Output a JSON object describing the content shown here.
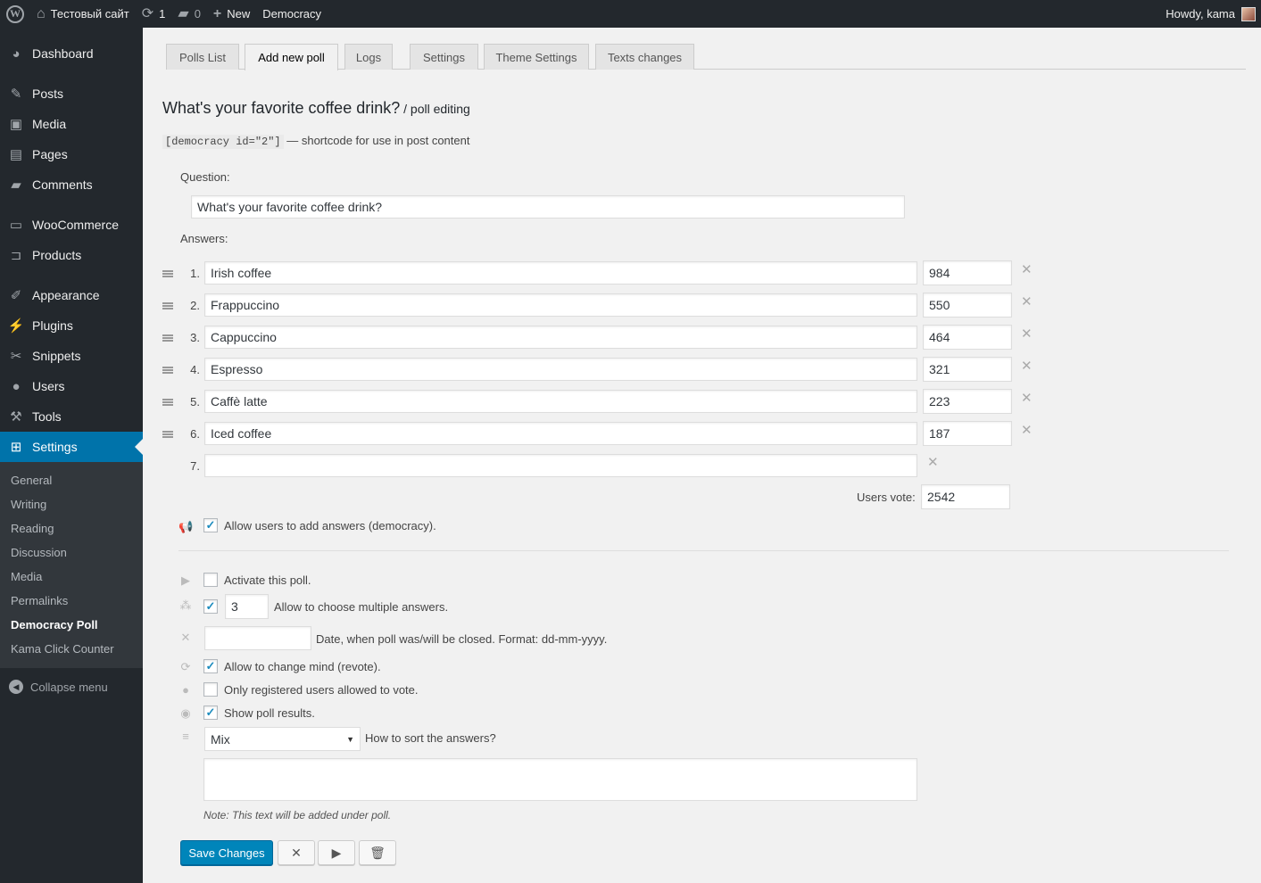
{
  "adminbar": {
    "site_name": "Тестовый сайт",
    "updates_count": "1",
    "comments_count": "0",
    "new_label": "New",
    "democracy_label": "Democracy",
    "howdy": "Howdy, kama"
  },
  "sidebar": {
    "items": [
      {
        "label": "Dashboard",
        "icon": "dashboard-icon",
        "glyph": "◕"
      },
      {
        "label": "Posts",
        "icon": "pin-icon",
        "glyph": "✎"
      },
      {
        "label": "Media",
        "icon": "media-icon",
        "glyph": "▣"
      },
      {
        "label": "Pages",
        "icon": "pages-icon",
        "glyph": "▤"
      },
      {
        "label": "Comments",
        "icon": "comment-icon",
        "glyph": "▰"
      },
      {
        "label": "WooCommerce",
        "icon": "woocommerce-icon",
        "glyph": "▭"
      },
      {
        "label": "Products",
        "icon": "cart-icon",
        "glyph": "⊐"
      },
      {
        "label": "Appearance",
        "icon": "brush-icon",
        "glyph": "✐"
      },
      {
        "label": "Plugins",
        "icon": "plug-icon",
        "glyph": "⚡"
      },
      {
        "label": "Snippets",
        "icon": "scissors-icon",
        "glyph": "✂"
      },
      {
        "label": "Users",
        "icon": "user-icon",
        "glyph": "●"
      },
      {
        "label": "Tools",
        "icon": "wrench-icon",
        "glyph": "⚒"
      },
      {
        "label": "Settings",
        "icon": "settings-icon",
        "glyph": "⊞"
      }
    ],
    "submenu": [
      "General",
      "Writing",
      "Reading",
      "Discussion",
      "Media",
      "Permalinks",
      "Democracy Poll",
      "Kama Click Counter"
    ],
    "collapse": "Collapse menu"
  },
  "tabs": [
    "Polls List",
    "Add new poll",
    "Logs",
    "Settings",
    "Theme Settings",
    "Texts changes"
  ],
  "title": "What's your favorite coffee drink?",
  "title_suffix": " / poll editing",
  "shortcode": "[democracy id=\"2\"]",
  "shortcode_note": " — shortcode for use in post content",
  "question_label": "Question:",
  "question_value": "What's your favorite coffee drink?",
  "answers_label": "Answers:",
  "answers": [
    {
      "num": "1.",
      "text": "Irish coffee",
      "votes": "984"
    },
    {
      "num": "2.",
      "text": "Frappuccino",
      "votes": "550"
    },
    {
      "num": "3.",
      "text": "Cappuccino",
      "votes": "464"
    },
    {
      "num": "4.",
      "text": "Espresso",
      "votes": "321"
    },
    {
      "num": "5.",
      "text": "Caffè latte",
      "votes": "223"
    },
    {
      "num": "6.",
      "text": "Iced coffee",
      "votes": "187"
    },
    {
      "num": "7.",
      "text": "",
      "votes": ""
    }
  ],
  "users_vote_label": "Users vote:",
  "users_vote_value": "2542",
  "options": {
    "democracy": {
      "label": "Allow users to add answers (democracy).",
      "checked": true
    },
    "activate": {
      "label": "Activate this poll.",
      "checked": false
    },
    "multiple": {
      "label": "Allow to choose multiple answers.",
      "checked": true,
      "value": "3"
    },
    "end_date": {
      "label": "Date, when poll was/will be closed. Format: dd-mm-yyyy.",
      "value": ""
    },
    "revote": {
      "label": "Allow to change mind (revote).",
      "checked": true
    },
    "only_registered": {
      "label": "Only registered users allowed to vote.",
      "checked": false
    },
    "show_results": {
      "label": "Show poll results.",
      "checked": true
    },
    "sort": {
      "label": "How to sort the answers?",
      "value": "Mix"
    }
  },
  "note": "Note: This text will be added under poll.",
  "buttons": {
    "save": "Save Changes",
    "cancel_glyph": "✕",
    "play_glyph": "▶",
    "trash_glyph": "🗑"
  },
  "colors": {
    "accent": "#0073aa",
    "primary_button": "#0085ba",
    "admin_bg": "#23282d"
  }
}
